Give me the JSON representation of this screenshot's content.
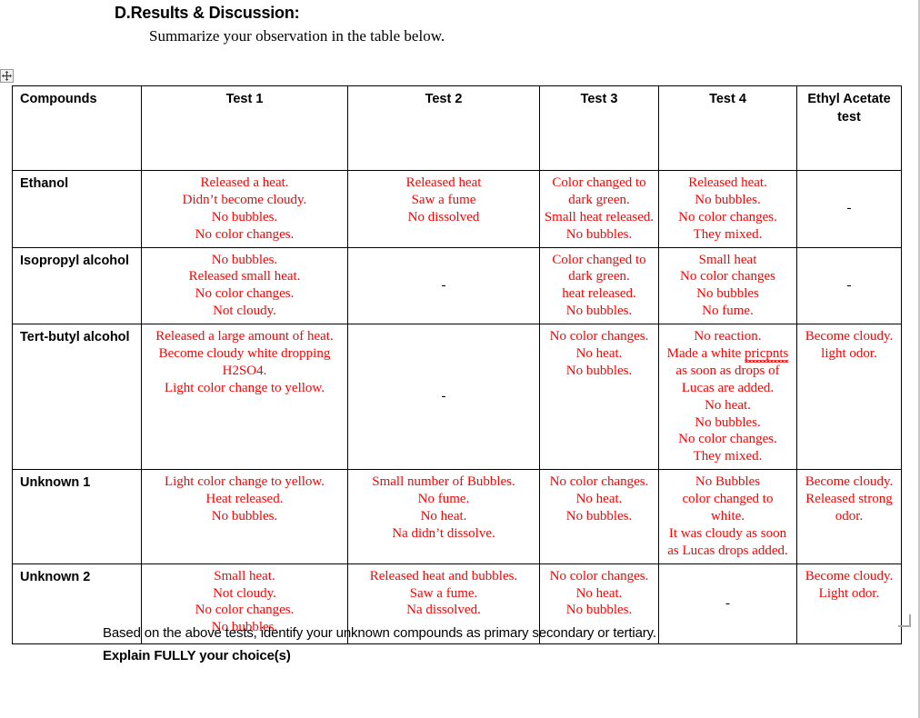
{
  "document": {
    "section_heading": "D.Results & Discussion:",
    "section_instruction": "Summarize your observation in the table below.",
    "footer_line_1": "Based on the above tests, identify your unknown compounds as primary secondary or tertiary.",
    "footer_line_2": "Explain FULLY your choice(s)"
  },
  "colors": {
    "observation_text": "#FF0000",
    "heading_text": "#000000",
    "table_border": "#000000"
  },
  "table": {
    "headers": {
      "compounds": "Compounds",
      "test1": "Test 1",
      "test2": "Test 2",
      "test3": "Test 3",
      "test4": "Test 4",
      "ethyl_acetate": "Ethyl Acetate test"
    },
    "rows": [
      {
        "compound": "Ethanol",
        "test1": [
          "Released a heat.",
          "Didn’t become cloudy.",
          "No bubbles.",
          "No color changes."
        ],
        "test2": [
          "Released heat",
          "Saw a fume",
          "No dissolved"
        ],
        "test3": [
          "Color changed to",
          "dark green.",
          "Small heat released.",
          "No bubbles."
        ],
        "test4": [
          "Released heat.",
          "No bubbles.",
          "No color changes.",
          "They mixed."
        ],
        "ethyl_acetate": [
          "-"
        ]
      },
      {
        "compound": "Isopropyl alcohol",
        "test1": [
          "No bubbles.",
          "Released small heat.",
          "No color changes.",
          "Not cloudy."
        ],
        "test2": [
          "-"
        ],
        "test3": [
          "Color changed to",
          "dark green.",
          "heat released.",
          "No bubbles."
        ],
        "test4": [
          "Small heat",
          "No color changes",
          "No bubbles",
          "No fume."
        ],
        "ethyl_acetate": [
          "-"
        ]
      },
      {
        "compound": "Tert-butyl alcohol",
        "test1": [
          "Released a large amount of heat.",
          "Become cloudy white dropping H2SO4.",
          "Light color change to yellow."
        ],
        "test2": [
          "-"
        ],
        "test3": [
          "No color changes.",
          "No heat.",
          "No bubbles."
        ],
        "test4_pre": "Made a white ",
        "test4_misspelled": "pricpnts",
        "test4": [
          "No reaction.",
          "as soon as drops of",
          "Lucas are added.",
          "No heat.",
          "No bubbles.",
          "No color changes.",
          "They mixed."
        ],
        "ethyl_acetate": [
          "Become cloudy.",
          "light odor."
        ]
      },
      {
        "compound": "Unknown 1",
        "test1": [
          "Light color change to yellow.",
          "Heat released.",
          "No bubbles."
        ],
        "test2": [
          "Small number of Bubbles.",
          "No fume.",
          "No heat.",
          "Na didn’t dissolve."
        ],
        "test3": [
          "No color changes.",
          "No heat.",
          "No bubbles."
        ],
        "test4": [
          "No Bubbles",
          "color changed to",
          "white.",
          "It was cloudy as soon",
          "as Lucas drops added."
        ],
        "ethyl_acetate": [
          "Become cloudy.",
          "Released strong odor."
        ]
      },
      {
        "compound": "Unknown 2",
        "test1": [
          "Small heat.",
          "Not cloudy.",
          "No color changes.",
          "No bubbles."
        ],
        "test2": [
          "Released heat and bubbles.",
          "Saw a fume.",
          "Na dissolved."
        ],
        "test3": [
          "No color changes.",
          "No heat.",
          "No bubbles."
        ],
        "test4": [
          "-"
        ],
        "ethyl_acetate": [
          "Become cloudy.",
          "Light odor."
        ]
      }
    ]
  }
}
